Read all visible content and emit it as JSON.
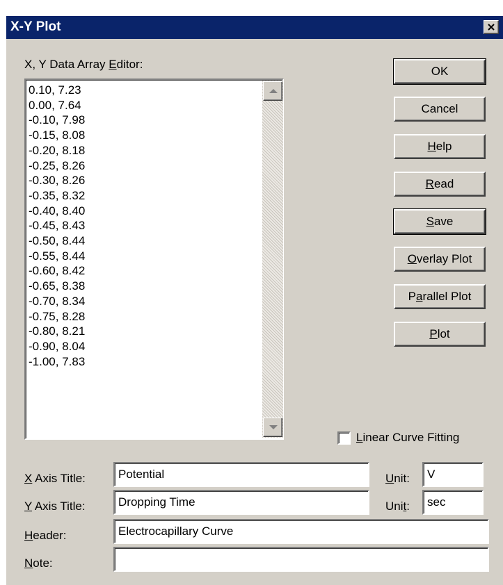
{
  "window": {
    "title": "X-Y Plot"
  },
  "editor": {
    "label_before": "X, Y Data Array ",
    "label_key": "E",
    "label_after": "ditor:",
    "lines": [
      "0.10, 7.23",
      "0.00, 7.64",
      "-0.10, 7.98",
      "-0.15, 8.08",
      "-0.20, 8.18",
      "-0.25, 8.26",
      "-0.30, 8.26",
      "-0.35, 8.32",
      "-0.40, 8.40",
      "-0.45, 8.43",
      "-0.50, 8.44",
      "-0.55, 8.44",
      "-0.60, 8.42",
      "-0.65, 8.38",
      "-0.70, 8.34",
      "-0.75, 8.28",
      "-0.80, 8.21",
      "-0.90, 8.04",
      "-1.00, 7.83"
    ]
  },
  "buttons": {
    "ok": "OK",
    "cancel": "Cancel",
    "help_key": "H",
    "help_rest": "elp",
    "read_key": "R",
    "read_rest": "ead",
    "save_key": "S",
    "save_rest": "ave",
    "overlay_key": "O",
    "overlay_rest": "verlay Plot",
    "parallel_pre": "P",
    "parallel_key": "a",
    "parallel_rest": "rallel Plot",
    "plot_key": "P",
    "plot_rest": "lot"
  },
  "linear_fit": {
    "key": "L",
    "rest": "inear Curve Fitting",
    "checked": false
  },
  "form": {
    "x_axis_key": "X",
    "x_axis_rest": " Axis Title:",
    "x_axis_value": "Potential",
    "x_unit_key": "U",
    "x_unit_rest": "nit:",
    "x_unit_value": "V",
    "y_axis_key": "Y",
    "y_axis_rest": " Axis Title:",
    "y_axis_value": "Dropping Time",
    "y_unit_pre": "Uni",
    "y_unit_key": "t",
    "y_unit_rest": ":",
    "y_unit_value": "sec",
    "header_key": "H",
    "header_rest": "eader:",
    "header_value": "Electrocapillary Curve",
    "note_key": "N",
    "note_rest": "ote:",
    "note_value": ""
  }
}
